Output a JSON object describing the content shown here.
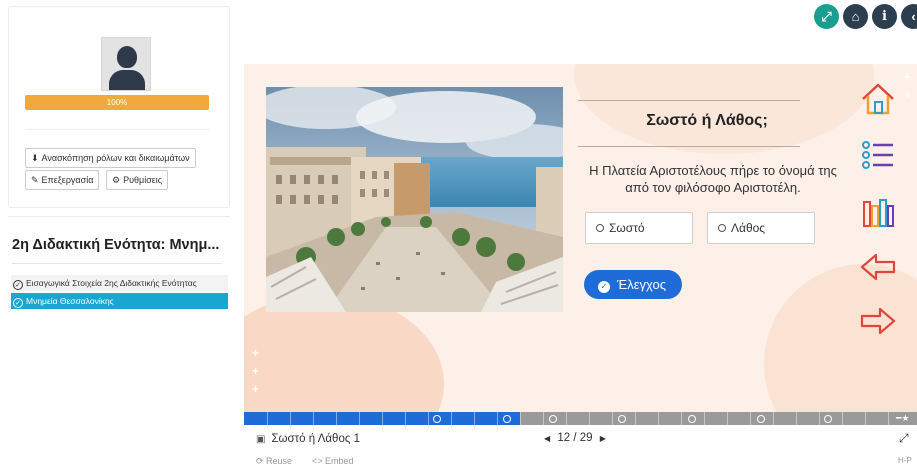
{
  "profile": {
    "progress_label": "100%",
    "progress_fraction": 1.0,
    "overview_button": "Ανασκόπηση ρόλων και δικαιωμάτων",
    "edit_button": "Επεξεργασία",
    "settings_button": "Ρυθμίσεις"
  },
  "unit": {
    "title": "2η Διδακτική Ενότητα: Μνημ...",
    "lessons": [
      {
        "label": "Εισαγωγικά Στοιχεία 2ης Διδακτικής Ενότητας"
      },
      {
        "label": "Μνημεία Θεσσαλονίκης"
      }
    ]
  },
  "top_buttons": [
    {
      "icon": "expand-icon",
      "glyph": "⤢",
      "color": "#1a9e8f"
    },
    {
      "icon": "home-icon",
      "glyph": "⌂",
      "color": "#2c3e50"
    },
    {
      "icon": "info-icon",
      "glyph": "i",
      "color": "#2c3e50"
    },
    {
      "icon": "back-icon",
      "glyph": "‹",
      "color": "#2c3e50"
    }
  ],
  "question": {
    "title": "Σωστό ή Λάθος;",
    "text": "Η Πλατεία Αριστοτέλους πήρε το όνομά της από τον φιλόσοφο Αριστοτέλη.",
    "answer_true": "Σωστό",
    "answer_false": "Λάθος",
    "check_label": "Έλεγχος"
  },
  "colors": {
    "accent_blue": "#1f6bd7",
    "progress_orange": "#f2a93b",
    "active_lesson": "#18a6d3",
    "icon_red": "#e0463c"
  },
  "footer": {
    "slide_title": "Σωστό ή Λάθος 1",
    "pager": "12 / 29",
    "current_slide": 12,
    "total_slides": 29,
    "reuse": "Reuse",
    "embed": "Embed",
    "brand": "H-P"
  }
}
